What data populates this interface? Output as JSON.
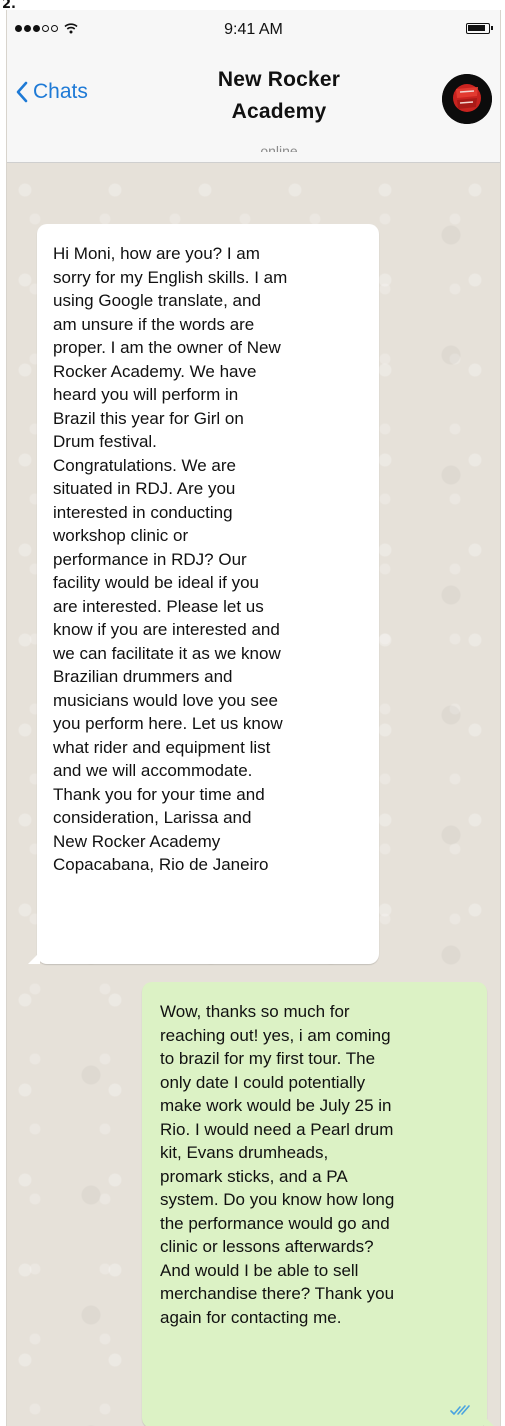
{
  "page_fragment": "2.",
  "status_bar": {
    "time": "9:41 AM",
    "signal_bars_filled": 3,
    "signal_bars_total": 5
  },
  "nav": {
    "back_label": "Chats",
    "title_line1": "New Rocker",
    "title_line2": "Academy",
    "status": "online",
    "accent_color": "#1e7ad6",
    "avatar_icon": "new-rocker-logo-icon"
  },
  "messages": [
    {
      "direction": "incoming",
      "lines": [
        "Hi Moni, how are you? I am",
        "sorry for my English skills. I am",
        "using Google translate, and",
        "am unsure if the words are",
        "proper. I am the owner of New",
        "Rocker Academy. We have",
        "heard you will perform in",
        "Brazil this year for Girl on",
        "Drum festival.",
        "Congratulations. We are",
        "situated in RDJ. Are you",
        "interested in conducting",
        "workshop clinic or",
        "performance in RDJ? Our",
        "facility would be ideal if you",
        "are interested. Please let us",
        "know if you are interested and",
        "we can facilitate it as we know",
        "Brazilian drummers and",
        "musicians would love you see",
        "you perform here. Let us know",
        "what rider and equipment list",
        "and we will accommodate.",
        "Thank you for your time and",
        "consideration, Larissa and",
        "New Rocker Academy",
        "Copacabana, Rio de Janeiro"
      ]
    },
    {
      "direction": "outgoing",
      "bubble_color": "#dcf2c5",
      "read_receipt_icon": "double-check-icon",
      "lines": [
        "Wow, thanks so much for",
        "reaching out! yes, i am coming",
        "to brazil for my first tour. The",
        "only date I could potentially",
        "make work would be July 25 in",
        "Rio. I would need a Pearl drum",
        "kit, Evans drumheads,",
        "promark sticks, and a PA",
        "system. Do you know how long",
        "the performance would go and",
        "clinic or lessons afterwards?",
        "And would I be able to sell",
        "merchandise there? Thank you",
        "again for contacting me."
      ]
    }
  ]
}
